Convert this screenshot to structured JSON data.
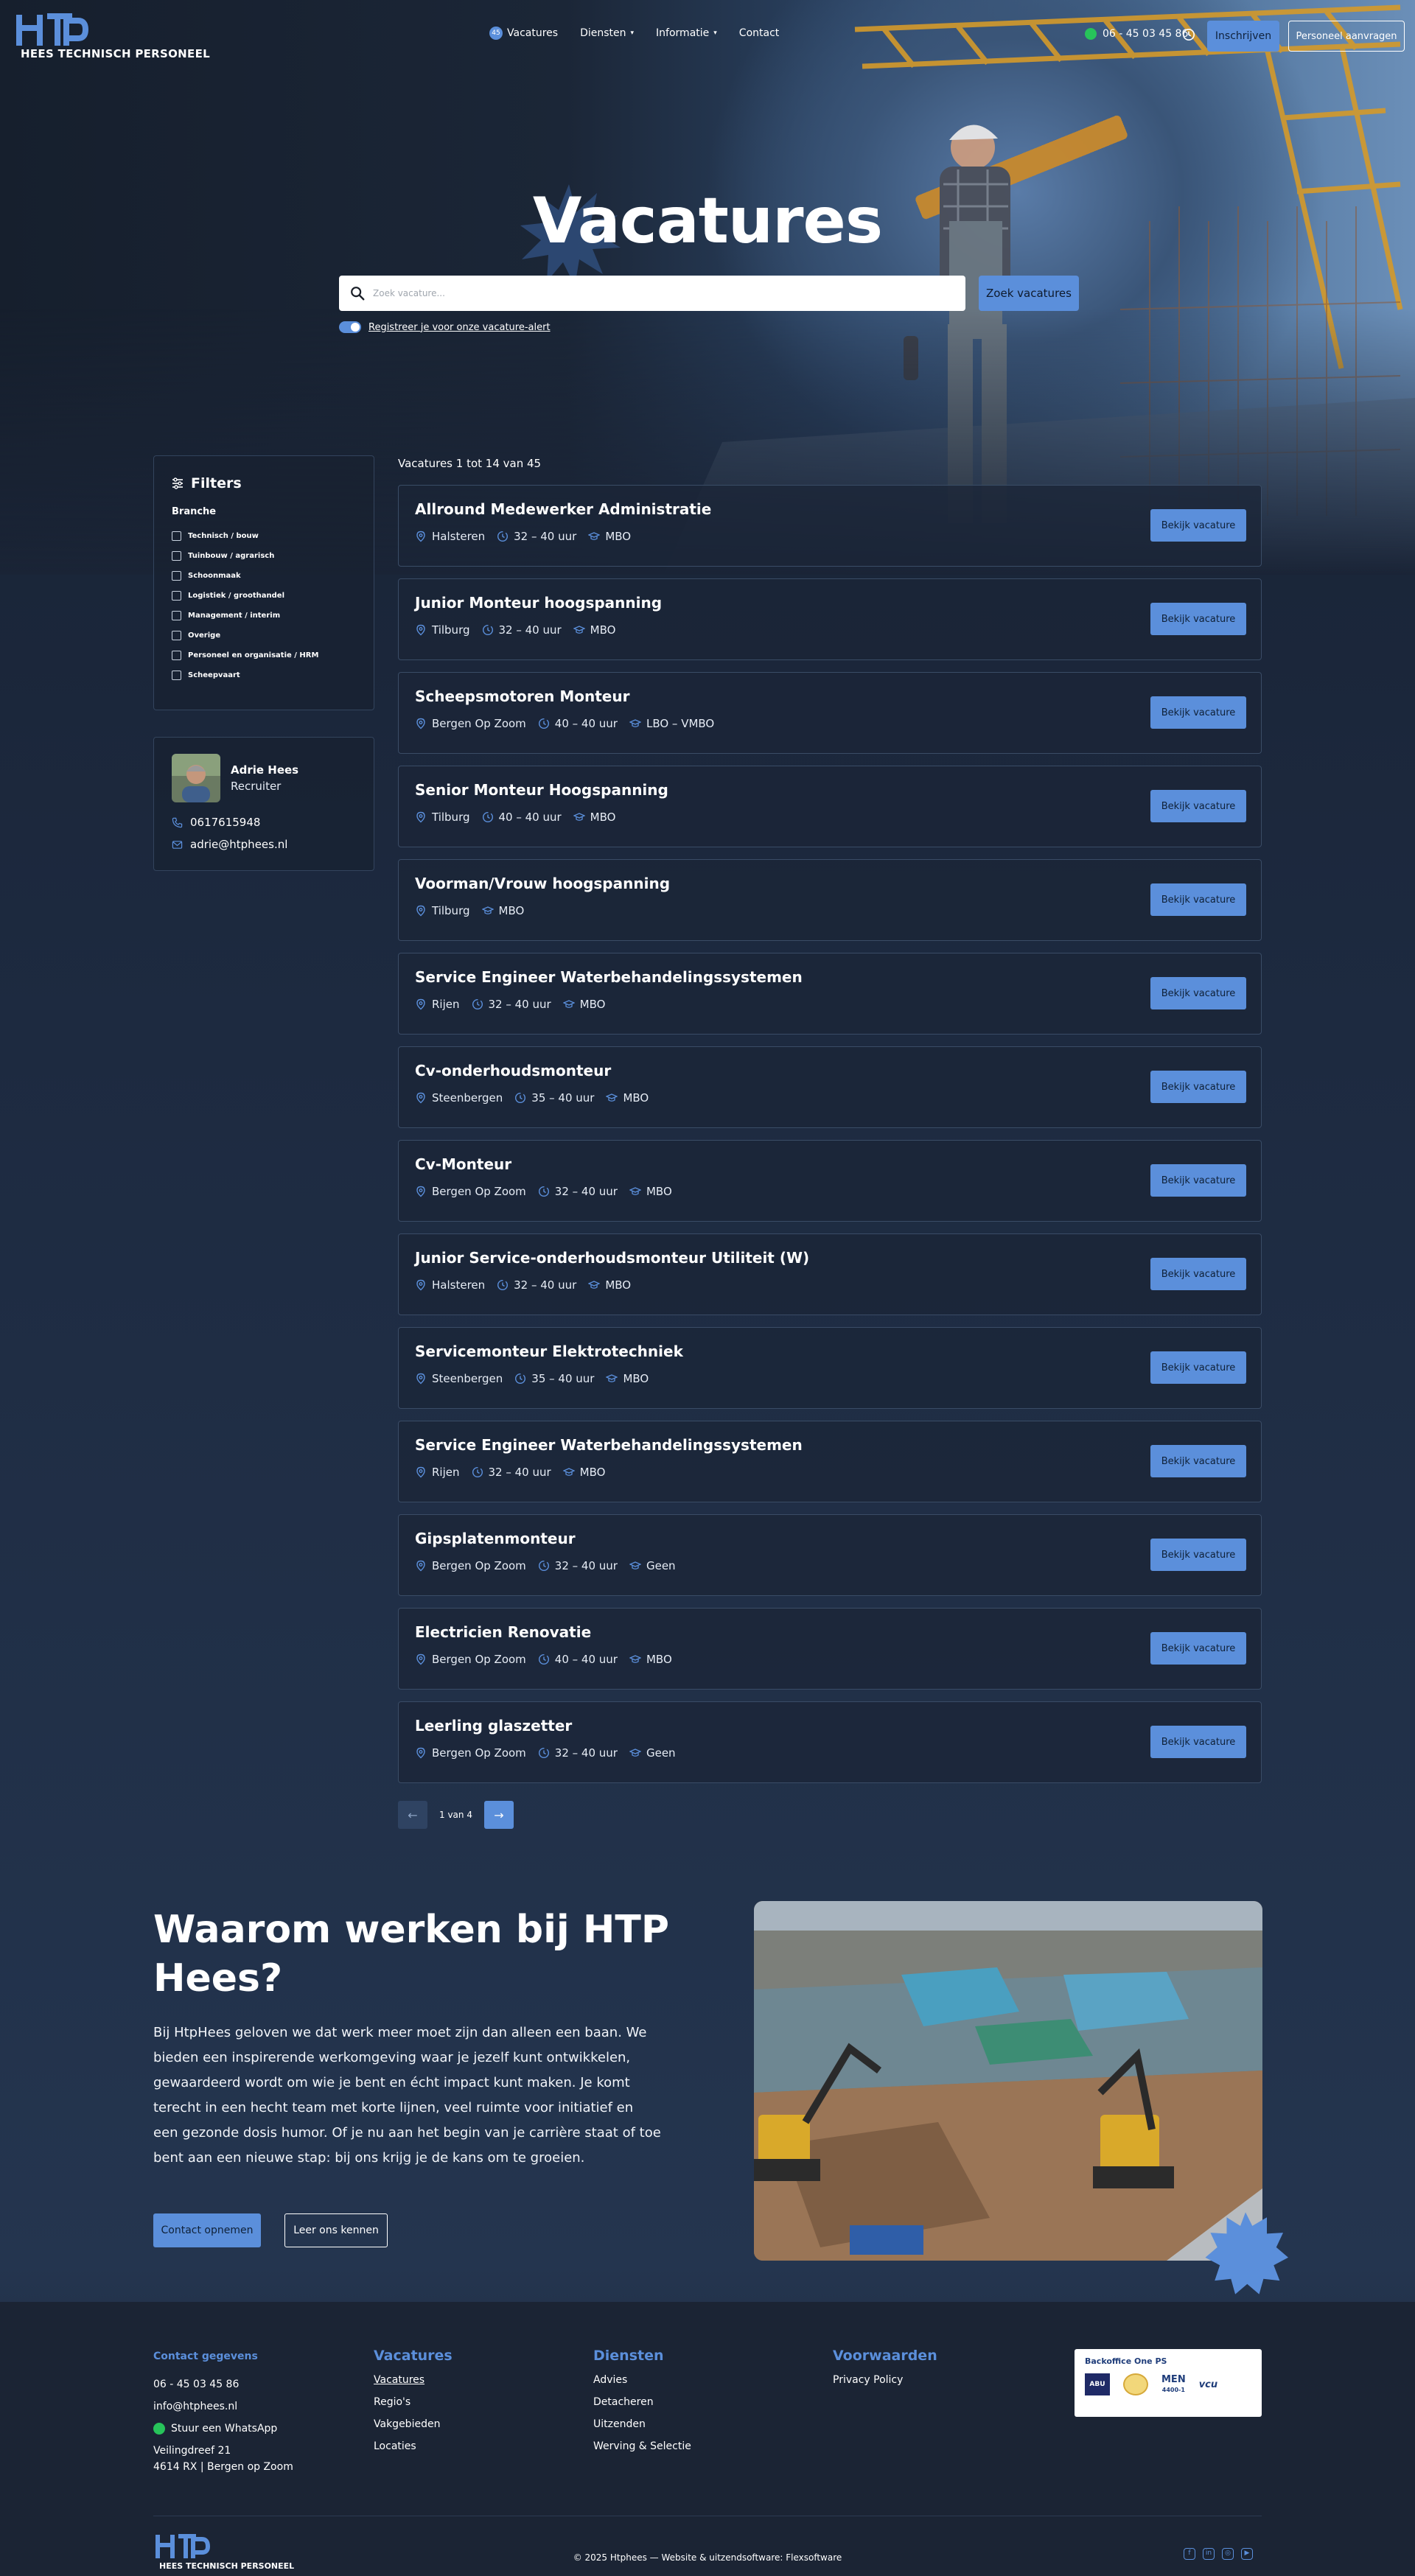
{
  "header": {
    "logo_text": "HEES TECHNISCH PERSONEEL",
    "nav": {
      "vacatures_count": "45",
      "vacatures": "Vacatures",
      "diensten": "Diensten",
      "informatie": "Informatie",
      "contact": "Contact"
    },
    "phone": "06 - 45 03 45 86",
    "btn_inschrijven": "Inschrijven",
    "btn_personeel": "Personeel aanvragen"
  },
  "hero": {
    "title": "Vacatures",
    "search_placeholder": "Zoek vacature...",
    "search_button": "Zoek vacatures",
    "alert_link": "Registreer je voor onze vacature-alert"
  },
  "filters": {
    "title": "Filters",
    "group_title": "Branche",
    "options": [
      "Technisch / bouw",
      "Tuinbouw / agrarisch",
      "Schoonmaak",
      "Logistiek / groothandel",
      "Management / interim",
      "Overige",
      "Personeel en organisatie / HRM",
      "Scheepvaart"
    ]
  },
  "recruiter": {
    "name": "Adrie Hees",
    "role": "Recruiter",
    "phone": "0617615948",
    "email": "adrie@htphees.nl"
  },
  "results": {
    "count_text": "Vacatures 1 tot 14 van 45",
    "button_label": "Bekijk vacature",
    "items": [
      {
        "title": "Allround Medewerker Administratie",
        "location": "Halsteren",
        "hours": "32 – 40 uur",
        "level": "MBO"
      },
      {
        "title": "Junior Monteur hoogspanning",
        "location": "Tilburg",
        "hours": "32 – 40 uur",
        "level": "MBO"
      },
      {
        "title": "Scheepsmotoren Monteur",
        "location": "Bergen Op Zoom",
        "hours": "40 – 40 uur",
        "level": "LBO – VMBO"
      },
      {
        "title": "Senior Monteur Hoogspanning",
        "location": "Tilburg",
        "hours": "40 – 40 uur",
        "level": "MBO"
      },
      {
        "title": "Voorman/Vrouw hoogspanning",
        "location": "Tilburg",
        "hours": "",
        "level": "MBO"
      },
      {
        "title": "Service Engineer Waterbehandelingssystemen",
        "location": "Rijen",
        "hours": "32 – 40 uur",
        "level": "MBO"
      },
      {
        "title": "Cv-onderhoudsmonteur",
        "location": "Steenbergen",
        "hours": "35 – 40 uur",
        "level": "MBO"
      },
      {
        "title": "Cv-Monteur",
        "location": "Bergen Op Zoom",
        "hours": "32 – 40 uur",
        "level": "MBO"
      },
      {
        "title": "Junior Service-onderhoudsmonteur Utiliteit (W)",
        "location": "Halsteren",
        "hours": "32 – 40 uur",
        "level": "MBO"
      },
      {
        "title": "Servicemonteur Elektrotechniek",
        "location": "Steenbergen",
        "hours": "35 – 40 uur",
        "level": "MBO"
      },
      {
        "title": "Service Engineer Waterbehandelingssystemen",
        "location": "Rijen",
        "hours": "32 – 40 uur",
        "level": "MBO"
      },
      {
        "title": "Gipsplatenmonteur",
        "location": "Bergen Op Zoom",
        "hours": "32 – 40 uur",
        "level": "Geen"
      },
      {
        "title": "Electricien Renovatie",
        "location": "Bergen Op Zoom",
        "hours": "40 – 40 uur",
        "level": "MBO"
      },
      {
        "title": "Leerling glaszetter",
        "location": "Bergen Op Zoom",
        "hours": "32 – 40 uur",
        "level": "Geen"
      }
    ]
  },
  "pagination": {
    "prev": "←",
    "text": "1 van 4",
    "next": "→"
  },
  "why": {
    "title": "Waarom werken bij HTP Hees?",
    "body": "Bij HtpHees geloven we dat werk meer moet zijn dan alleen een baan. We bieden een inspirerende werkomgeving waar je jezelf kunt ontwikkelen, gewaardeerd wordt om wie je bent en écht impact kunt maken. Je komt terecht in een hecht team met korte lijnen, veel ruimte voor initiatief en een gezonde dosis humor. Of je nu aan het begin van je carrière staat of toe bent aan een nieuwe stap: bij ons krijg je de kans om te groeien.",
    "btn_contact": "Contact opnemen",
    "btn_meet": "Leer ons kennen"
  },
  "footer": {
    "contact": {
      "title": "Contact gegevens",
      "phone": "06 - 45 03 45 86",
      "email": "info@htphees.nl",
      "whatsapp": "Stuur een WhatsApp",
      "address1": "Veilingdreef 21",
      "address2": "4614 RX | Bergen op Zoom"
    },
    "vacatures": {
      "title": "Vacatures",
      "links": [
        "Vacatures",
        "Regio's",
        "Vakgebieden",
        "Locaties"
      ]
    },
    "diensten": {
      "title": "Diensten",
      "links": [
        "Advies",
        "Detacheren",
        "Uitzenden",
        "Werving & Selectie"
      ]
    },
    "voorwaarden": {
      "title": "Voorwaarden",
      "links": [
        "Privacy Policy"
      ]
    },
    "certs": {
      "title": "Backoffice One PS",
      "labels": [
        "ABU",
        "MEN",
        "4400-1",
        "vcu"
      ]
    },
    "logo_text": "HEES TECHNISCH PERSONEEL",
    "copyright": "© 2025 Htphees — Website & uitzendsoftware: Flexsoftware",
    "social_glyphs": [
      "f",
      "in",
      "◎",
      "▶"
    ]
  },
  "colors": {
    "accent": "#5b8fdb",
    "background": "#1a2436",
    "footer": "#1b2434",
    "whatsapp": "#27c35a"
  }
}
